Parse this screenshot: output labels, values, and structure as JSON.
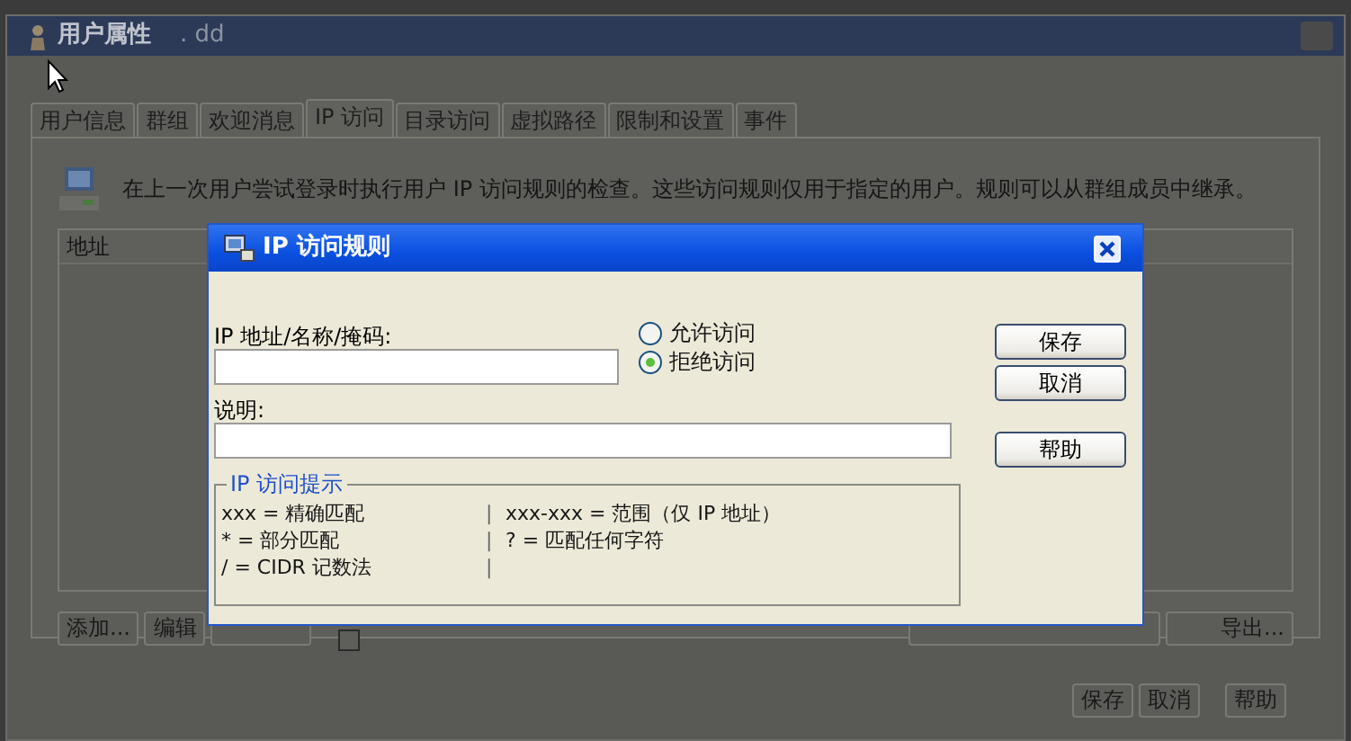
{
  "window": {
    "title": "用户属性",
    "subtitle": ". dd"
  },
  "tabs": [
    {
      "label": "用户信息",
      "selected": false
    },
    {
      "label": "群组",
      "selected": false
    },
    {
      "label": "欢迎消息",
      "selected": false
    },
    {
      "label": "IP 访问",
      "selected": true
    },
    {
      "label": "目录访问",
      "selected": false
    },
    {
      "label": "虚拟路径",
      "selected": false
    },
    {
      "label": "限制和设置",
      "selected": false
    },
    {
      "label": "事件",
      "selected": false
    }
  ],
  "info_text": "在上一次用户尝试登录时执行用户  IP 访问规则的检查。这些访问规则仅用于指定的用户。规则可以从群组成员中继承。",
  "list": {
    "columns": [
      "地址"
    ]
  },
  "list_buttons": [
    "添加...",
    "编辑"
  ],
  "list_checkbox": {
    "checked": false
  },
  "export_button": "导出...",
  "footer_buttons": [
    "保存",
    "取消",
    "帮助"
  ],
  "dialog": {
    "title": "IP 访问规则",
    "address_label": "IP 地址/名称/掩码:",
    "description_label": "说明:",
    "access_options": [
      {
        "label": "允许访问",
        "selected": false
      },
      {
        "label": "拒绝访问",
        "selected": true
      }
    ],
    "buttons": [
      "保存",
      "取消",
      "帮助"
    ],
    "hints": {
      "title": "IP 访问提示",
      "rows": [
        {
          "left": "xxx = 精确匹配",
          "separator": "|",
          "right": "xxx-xxx = 范围（仅  IP 地址）"
        },
        {
          "left": "* = 部分匹配",
          "separator": "|",
          "right": "? = 匹配任何字符"
        },
        {
          "left": "/ = CIDR 记数法",
          "separator": "|"
        }
      ]
    }
  }
}
